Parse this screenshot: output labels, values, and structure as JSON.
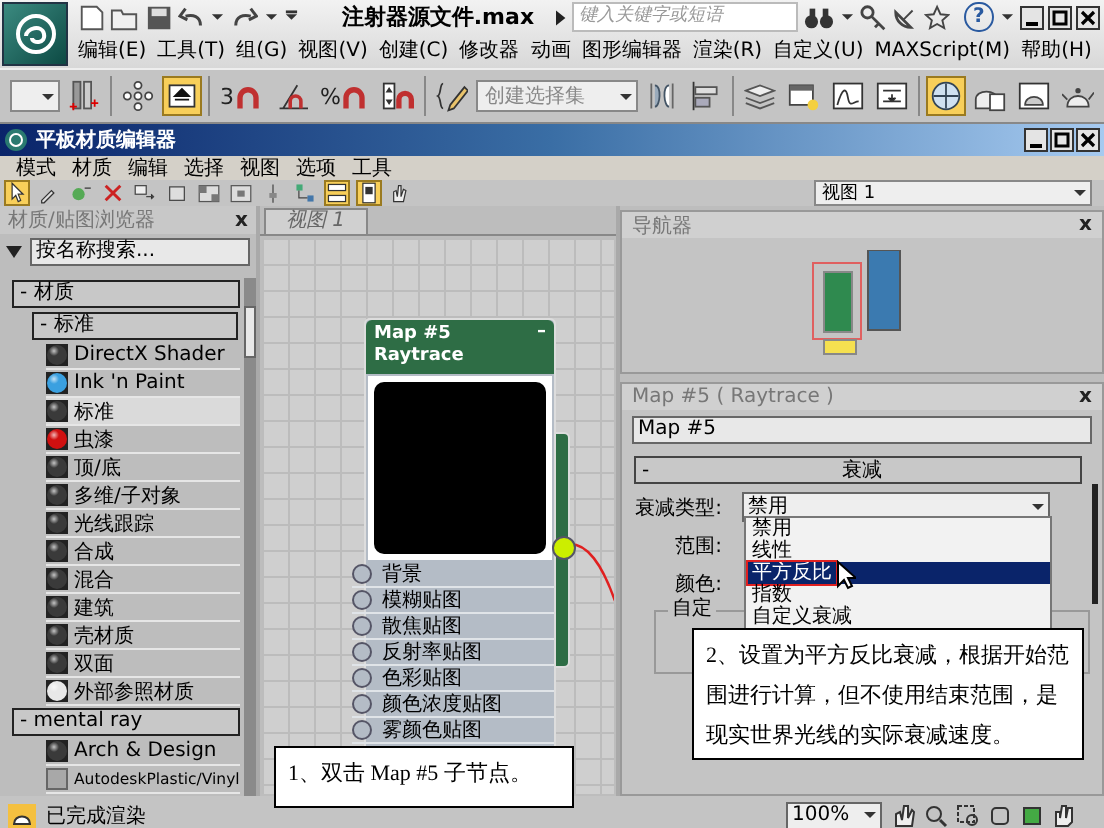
{
  "app": {
    "title": "注射器源文件.max",
    "search": {
      "placeholder": "键入关键字或短语"
    },
    "help": "?",
    "menu": [
      "编辑(E)",
      "工具(T)",
      "组(G)",
      "视图(V)",
      "创建(C)",
      "修改器",
      "动画",
      "图形编辑器",
      "渲染(R)",
      "自定义(U)",
      "MAXScript(M)",
      "帮助(H)"
    ]
  },
  "toolbar": {
    "tools": [
      {
        "on": false
      },
      {
        "on": false
      },
      {
        "on": true
      },
      {
        "label": "3",
        "on": false
      },
      {
        "on": false
      },
      {
        "label": "%",
        "on": false
      },
      {
        "on": false
      },
      {
        "on": false
      }
    ],
    "selection_set": {
      "placeholder": "创建选择集"
    },
    "tools_after": [
      {
        "on": false
      },
      {
        "on": false
      },
      {
        "on": false
      },
      {
        "on": false
      },
      {
        "on": false
      },
      {
        "on": false
      },
      {
        "on": true
      },
      {
        "on": false
      },
      {
        "on": false
      },
      {
        "on": false
      }
    ]
  },
  "editor": {
    "title": "平板材质编辑器",
    "menu": [
      "模式",
      "材质",
      "编辑",
      "选择",
      "视图",
      "选项",
      "工具"
    ],
    "tools": [
      {
        "on": true
      },
      {
        "on": false
      },
      {
        "on": false
      },
      {
        "on": false
      },
      {
        "on": false
      },
      {
        "on": false
      },
      {
        "on": false
      },
      {
        "on": false
      },
      {
        "on": false
      },
      {
        "on": false
      },
      {
        "on": true
      },
      {
        "on": true
      },
      {
        "on": false
      }
    ],
    "view_select": "视图 1"
  },
  "browser": {
    "title": "材质/贴图浏览器",
    "close": "x",
    "search": {
      "placeholder": "按名称搜索..."
    },
    "groups": [
      {
        "label": "- 材质",
        "children": [
          {
            "label": "- 标准",
            "children": [
              {
                "label": "DirectX Shader",
                "kind": "sphere",
                "color": "#3a3a3a",
                "selected": false
              },
              {
                "label": "Ink 'n Paint",
                "kind": "sphere",
                "color": "#3aa0e0",
                "selected": false
              },
              {
                "label": "标准",
                "kind": "sphere",
                "color": "#3a3a3a",
                "selected": true
              },
              {
                "label": "虫漆",
                "kind": "sphere",
                "color": "#d01010",
                "selected": false
              },
              {
                "label": "顶/底",
                "kind": "sphere",
                "color": "#3a3a3a",
                "selected": false
              },
              {
                "label": "多维/子对象",
                "kind": "sphere",
                "color": "#3a3a3a",
                "selected": false
              },
              {
                "label": "光线跟踪",
                "kind": "sphere",
                "color": "#3a3a3a",
                "selected": false
              },
              {
                "label": "合成",
                "kind": "sphere",
                "color": "#3a3a3a",
                "selected": false
              },
              {
                "label": "混合",
                "kind": "sphere",
                "color": "#3a3a3a",
                "selected": false
              },
              {
                "label": "建筑",
                "kind": "sphere",
                "color": "#3a3a3a",
                "selected": false
              },
              {
                "label": "壳材质",
                "kind": "sphere",
                "color": "#3a3a3a",
                "selected": false
              },
              {
                "label": "双面",
                "kind": "sphere",
                "color": "#3a3a3a",
                "selected": false
              },
              {
                "label": "外部参照材质",
                "kind": "sphere",
                "color": "#e8e8e8",
                "selected": false
              }
            ]
          }
        ]
      },
      {
        "label": "- mental ray",
        "children": [
          {
            "label": "Arch & Design",
            "kind": "sphere",
            "color": "#3a3a3a",
            "selected": false
          },
          {
            "label": "AutodeskPlastic/Vinyl",
            "kind": "swatch",
            "color": "#a8a8a8",
            "selected": false
          }
        ]
      }
    ]
  },
  "view": {
    "tab": "视图 1",
    "node": {
      "title": "Map #5",
      "type": "Raytrace",
      "collapse": "–",
      "slots": [
        "背景",
        "模糊贴图",
        "散焦贴图",
        "反射率贴图",
        "色彩贴图",
        "颜色浓度贴图",
        "雾颜色贴图"
      ]
    }
  },
  "navigator": {
    "title": "导航器",
    "close": "x"
  },
  "params": {
    "title": "Map #5 ( Raytrace )",
    "close": "x",
    "name": "Map #5",
    "rollout": "衰减",
    "rollout_toggle": "-",
    "falloff_label": "衰减类型:",
    "falloff_value": "禁用",
    "options": [
      {
        "label": "禁用",
        "selected": false
      },
      {
        "label": "线性",
        "selected": false
      },
      {
        "label": "平方反比",
        "selected": true
      },
      {
        "label": "指数",
        "selected": false
      },
      {
        "label": "自定义衰减",
        "selected": false
      }
    ],
    "range_label": "范围:",
    "color_label": "颜色:",
    "group_label": "自定"
  },
  "status": {
    "text": "已完成渲染",
    "zoom": "100%"
  },
  "callouts": [
    {
      "text": "1、双击 Map #5 子节点。"
    },
    {
      "text": "2、设置为平方反比衰减，根据开始范围进行计算，但不使用结束范围，是现实世界光线的实际衰减速度。"
    }
  ]
}
